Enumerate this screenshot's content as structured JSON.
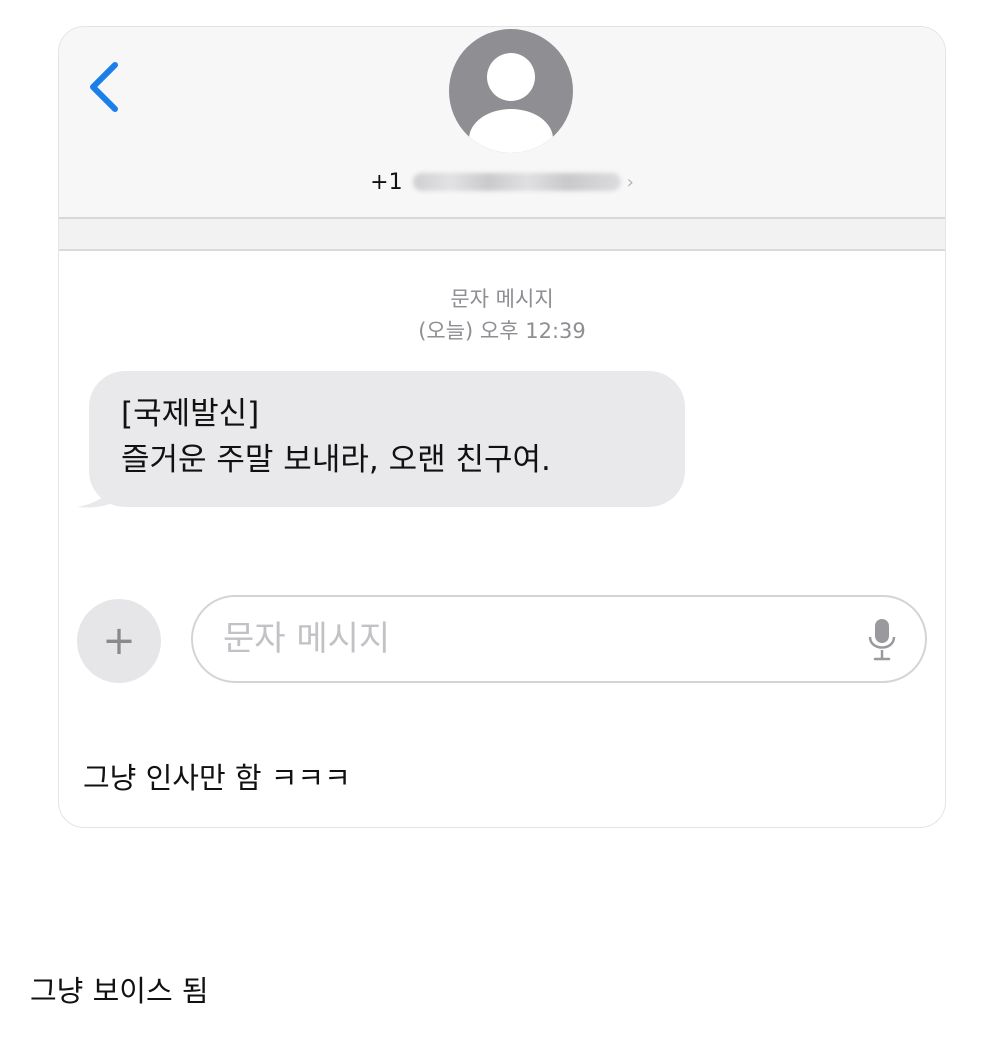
{
  "header": {
    "back_icon": "chevron-left-icon",
    "avatar_icon": "person-silhouette-icon",
    "contact_prefix": "+1",
    "contact_chevron": "›"
  },
  "thread": {
    "timestamp_type": "문자 메시지",
    "timestamp_time": "(오늘) 오후 12:39",
    "messages": [
      {
        "direction": "incoming",
        "lines": [
          "[국제발신]",
          "즐거운 주말 보내라, 오랜 친구여."
        ]
      }
    ]
  },
  "composer": {
    "add_label": "+",
    "placeholder": "문자 메시지",
    "mic_icon": "microphone-icon"
  },
  "captions": {
    "inside": "그냥 인사만 함 ㅋㅋㅋ",
    "below": "그냥 보이스 됨"
  },
  "colors": {
    "accent": "#1a7fe8",
    "avatar": "#8e8e93",
    "bubble": "#e9e9eb",
    "secondary_text": "#8e8e93"
  }
}
